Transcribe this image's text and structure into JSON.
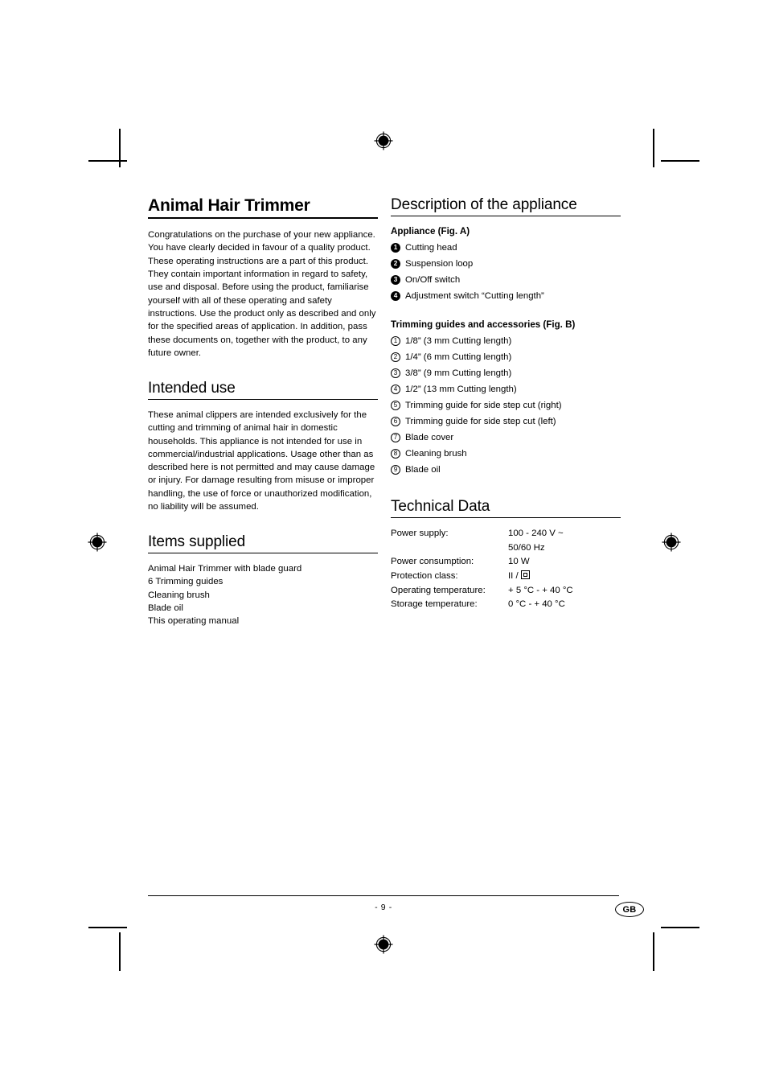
{
  "document": {
    "title": "Animal Hair Trimmer",
    "page_number": "- 9 -",
    "language_badge": "GB"
  },
  "left_column": {
    "intro_paragraphs": [
      "Congratulations on the purchase of your new appliance.",
      "You have clearly decided in favour of a quality product. These operating instructions are a part of this product. They contain important information in regard to safety, use and disposal. Before using the product, familiarise yourself with all of these operating and safety instructions. Use the product only as described and only for the specified areas of application. In addition, pass these documents on, together with the product, to any future owner."
    ],
    "intended_use": {
      "heading": "Intended use",
      "text": "These animal clippers are intended exclusively for the cutting and trimming of animal hair in domestic households. This appliance is not intended for use in commercial/industrial applications. Usage other than as described here is not permitted and may cause damage or injury. For damage resulting from misuse or improper handling, the use of force or unauthorized modification, no liability will be assumed."
    },
    "items_supplied": {
      "heading": "Items supplied",
      "items": [
        "Animal Hair Trimmer with blade guard",
        "6 Trimming guides",
        "Cleaning brush",
        "Blade oil",
        "This operating manual"
      ]
    }
  },
  "right_column": {
    "description": {
      "heading": "Description of the appliance",
      "appliance_subheading": "Appliance (Fig. A)",
      "appliance_items": [
        {
          "number": "1",
          "label": "Cutting head"
        },
        {
          "number": "2",
          "label": "Suspension loop"
        },
        {
          "number": "3",
          "label": "On/Off switch"
        },
        {
          "number": "4",
          "label": "Adjustment switch “Cutting length”"
        }
      ],
      "guides_subheading": "Trimming guides and accessories (Fig. B)",
      "guides_items": [
        {
          "number": "1",
          "label": "1/8” (3 mm Cutting length)"
        },
        {
          "number": "2",
          "label": "1/4” (6 mm Cutting length)"
        },
        {
          "number": "3",
          "label": "3/8” (9 mm Cutting length)"
        },
        {
          "number": "4",
          "label": "1/2” (13 mm Cutting length)"
        },
        {
          "number": "5",
          "label": "Trimming guide for side step cut (right)"
        },
        {
          "number": "6",
          "label": "Trimming guide for side step cut (left)"
        },
        {
          "number": "7",
          "label": "Blade cover"
        },
        {
          "number": "8",
          "label": "Cleaning brush"
        },
        {
          "number": "9",
          "label": "Blade oil"
        }
      ]
    },
    "technical_data": {
      "heading": "Technical Data",
      "rows": [
        {
          "label": "Power supply:",
          "value": "100 - 240 V ~",
          "value2": "50/60 Hz"
        },
        {
          "label": "Power consumption:",
          "value": "10 W"
        },
        {
          "label": "Protection class:",
          "value_prefix": "II /",
          "value_symbol": "class-2-double-insulation"
        },
        {
          "label": "Operating temperature:",
          "value": "+ 5 °C  -  + 40 °C"
        },
        {
          "label": "Storage temperature:",
          "value": "0 °C  -  + 40 °C"
        }
      ]
    }
  }
}
